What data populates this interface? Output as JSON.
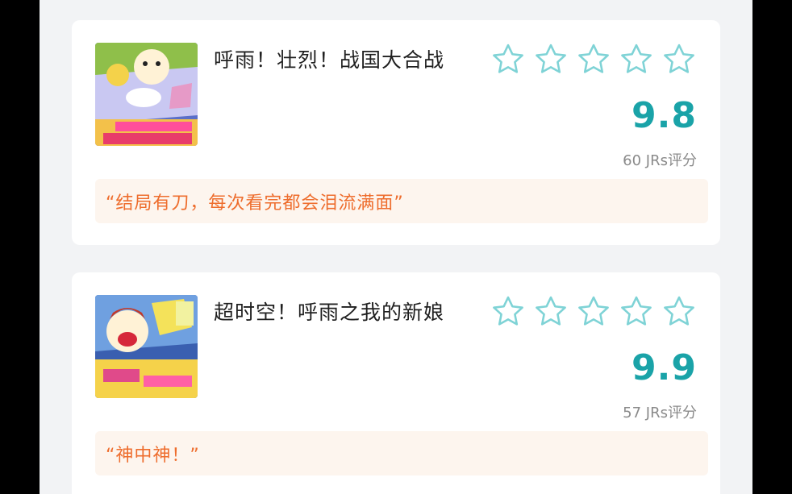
{
  "colors": {
    "score": "#1aa3a8",
    "star_outline": "#7fd3d6",
    "quote_text": "#ee6d2d",
    "quote_bg": "#fdf5ee"
  },
  "movies": [
    {
      "title": "呼雨！壮烈！战国大合战",
      "score": "9.8",
      "rating_count": "60 JRs评分",
      "quote": "“结局有刀，每次看完都会泪流满面”",
      "stars": 5,
      "poster_icon": "movie-poster"
    },
    {
      "title": "超时空！呼雨之我的新娘",
      "score": "9.9",
      "rating_count": "57 JRs评分",
      "quote": "“神中神！”",
      "stars": 5,
      "poster_icon": "movie-poster"
    }
  ]
}
